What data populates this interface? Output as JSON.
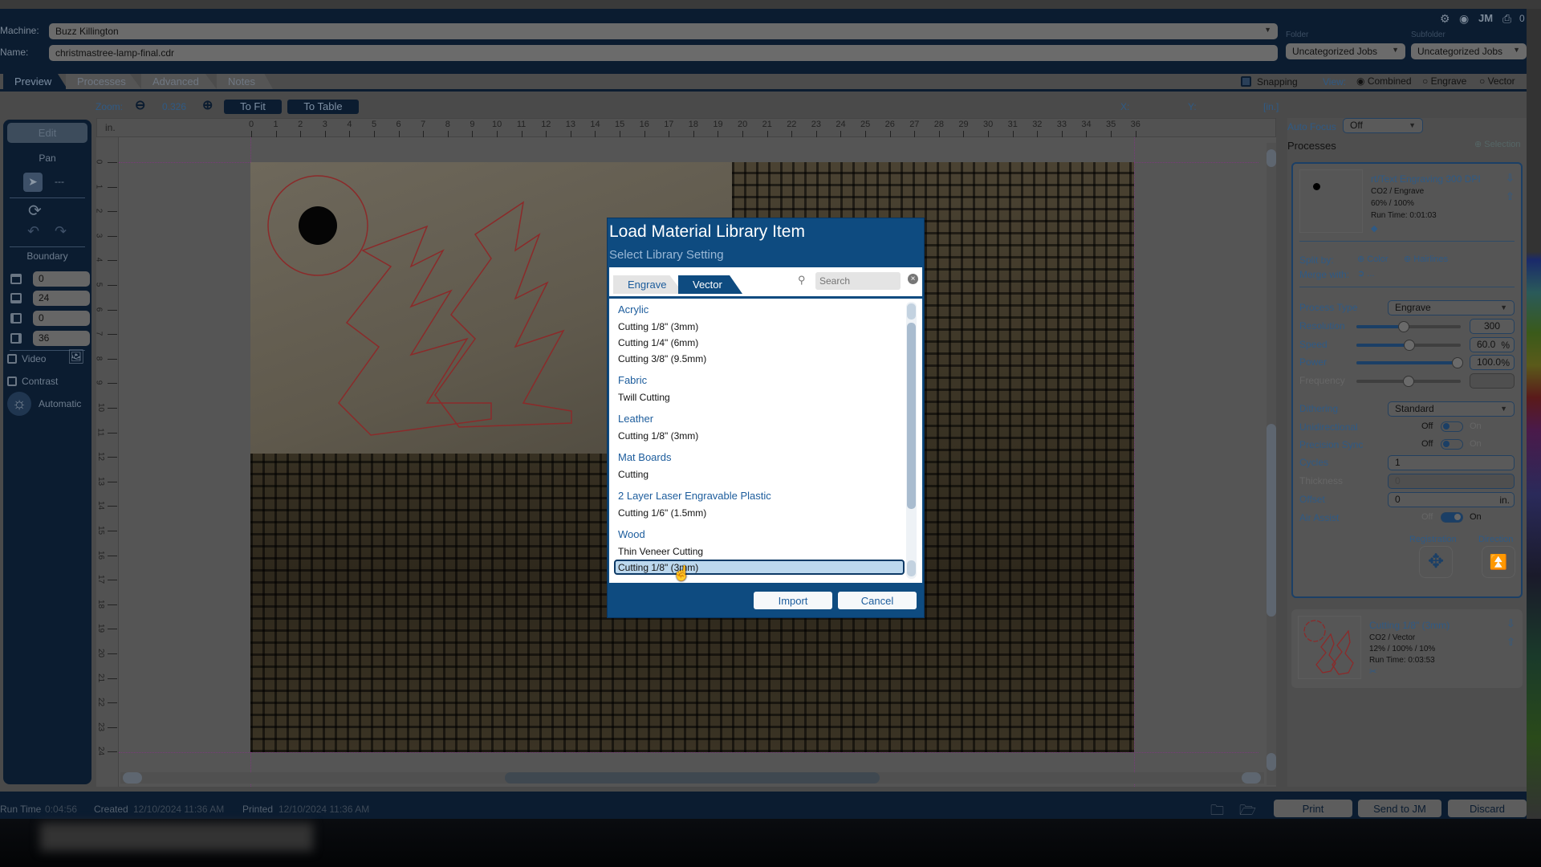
{
  "header": {
    "machine_label": "Machine:",
    "machine_value": "Buzz Killington",
    "name_label": "Name:",
    "name_value": "christmastree-lamp-final.cdr",
    "folder_label": "Folder",
    "folder_value": "Uncategorized Jobs",
    "subfolder_label": "Subfolder",
    "subfolder_value": "Uncategorized Jobs",
    "jm_label": "JM",
    "queue_count": "0"
  },
  "tabs": [
    {
      "label": "Preview",
      "active": true
    },
    {
      "label": "Processes"
    },
    {
      "label": "Advanced"
    },
    {
      "label": "Notes"
    }
  ],
  "view": {
    "snapping_label": "Snapping",
    "view_label": "View:",
    "options": [
      "Combined",
      "Engrave",
      "Vector"
    ],
    "selected": "Combined"
  },
  "toolbar": {
    "zoom_label": "Zoom:",
    "zoom_value": "0.326",
    "to_fit": "To Fit",
    "to_table": "To Table",
    "x_label": "X:",
    "y_label": "Y:",
    "units": "[in.]"
  },
  "ruler": {
    "unit": "in.",
    "h_ticks": [
      "0",
      "1",
      "2",
      "3",
      "4",
      "5",
      "6",
      "7",
      "8",
      "9",
      "10",
      "11",
      "12",
      "13",
      "14",
      "15",
      "16",
      "17",
      "18",
      "19",
      "20",
      "21",
      "22",
      "23",
      "24",
      "25",
      "26",
      "27",
      "28",
      "29",
      "30",
      "31",
      "32",
      "33",
      "34",
      "35",
      "36"
    ],
    "v_ticks": [
      "0",
      "1",
      "2",
      "3",
      "4",
      "5",
      "6",
      "7",
      "8",
      "9",
      "10",
      "11",
      "12",
      "13",
      "14",
      "15",
      "16",
      "17",
      "18",
      "19",
      "20",
      "21",
      "22",
      "23",
      "24"
    ]
  },
  "sidebar": {
    "edit": "Edit",
    "pan": "Pan",
    "dashes": "---",
    "boundary": "Boundary",
    "boundary_values": [
      "0",
      "24",
      "0",
      "36"
    ],
    "video": "Video",
    "contrast": "Contrast",
    "automatic": "Automatic"
  },
  "right": {
    "auto_focus_label": "Auto Focus",
    "auto_focus_value": "Off",
    "processes_label": "Processes",
    "selection_label": "Selection",
    "process1": {
      "title": "rt/Text Engraving 300 DPI",
      "type": "CO2 / Engrave",
      "settings": "60%  /  100%",
      "run_time": "Run Time: 0:01:03"
    },
    "split_by": "Split by:",
    "color": "Color",
    "hairlines": "Hairlines",
    "merge_with": "Merge with:",
    "merge_value": "...",
    "process_type_label": "Process Type",
    "process_type_value": "Engrave",
    "resolution_label": "Resolution",
    "resolution_value": "300",
    "resolution_fraction": 0.45,
    "speed_label": "Speed",
    "speed_value": "60.0",
    "speed_pct": 60,
    "power_label": "Power",
    "power_value": "100.0",
    "power_pct": 100,
    "percent": "%",
    "frequency_label": "Frequency",
    "frequency_fraction": 0.5,
    "dithering_label": "Dithering",
    "dithering_value": "Standard",
    "unidirectional_label": "Unidirectional",
    "precision_sync_label": "Precision Sync",
    "air_assist_label": "Air Assist",
    "off": "Off",
    "on": "On",
    "cycles_label": "Cycles",
    "cycles_value": "1",
    "thickness_label": "Thickness",
    "thickness_value": "0",
    "offset_label": "Offset",
    "offset_value": "0",
    "offset_unit": "in.",
    "registration_label": "Registration",
    "direction_label": "Direction",
    "process2": {
      "title": "Cutting 1/8\" (3mm)",
      "type": "CO2 / Vector",
      "settings": "12%  /  100%  /  10%",
      "run_time": "Run Time: 0:03:53"
    }
  },
  "bottom": {
    "run_time_label": "Run Time",
    "run_time": "0:04:56",
    "created_label": "Created",
    "created": "12/10/2024 11:36 AM",
    "printed_label": "Printed",
    "printed": "12/10/2024 11:36 AM",
    "print": "Print",
    "send_to_jm": "Send to JM",
    "discard": "Discard"
  },
  "dialog": {
    "title": "Load Material Library Item",
    "subtitle": "Select Library Setting",
    "tabs": [
      "Engrave",
      "Vector"
    ],
    "active_tab": "Vector",
    "search_placeholder": "Search",
    "groups": [
      {
        "name": "Acrylic",
        "items": [
          "Cutting 1/8\" (3mm)",
          "Cutting 1/4\" (6mm)",
          "Cutting 3/8\" (9.5mm)"
        ]
      },
      {
        "name": "Fabric",
        "items": [
          "Twill Cutting"
        ]
      },
      {
        "name": "Leather",
        "items": [
          "Cutting 1/8\" (3mm)"
        ]
      },
      {
        "name": "Mat Boards",
        "items": [
          "Cutting"
        ]
      },
      {
        "name": "2 Layer Laser Engravable Plastic",
        "items": [
          "Cutting 1/6\" (1.5mm)"
        ]
      },
      {
        "name": "Wood",
        "items": [
          "Thin Veneer Cutting",
          "Cutting 1/8\" (3mm)"
        ]
      }
    ],
    "selected": "Wood / Cutting 1/8\" (3mm)",
    "import": "Import",
    "cancel": "Cancel"
  },
  "colors": {
    "navy": "#0b1c30",
    "dialog_blue": "#0e4b80",
    "link_blue": "#1c5c9c",
    "selected_row": "#bcd8ee",
    "vector_red": "#c0392b"
  }
}
